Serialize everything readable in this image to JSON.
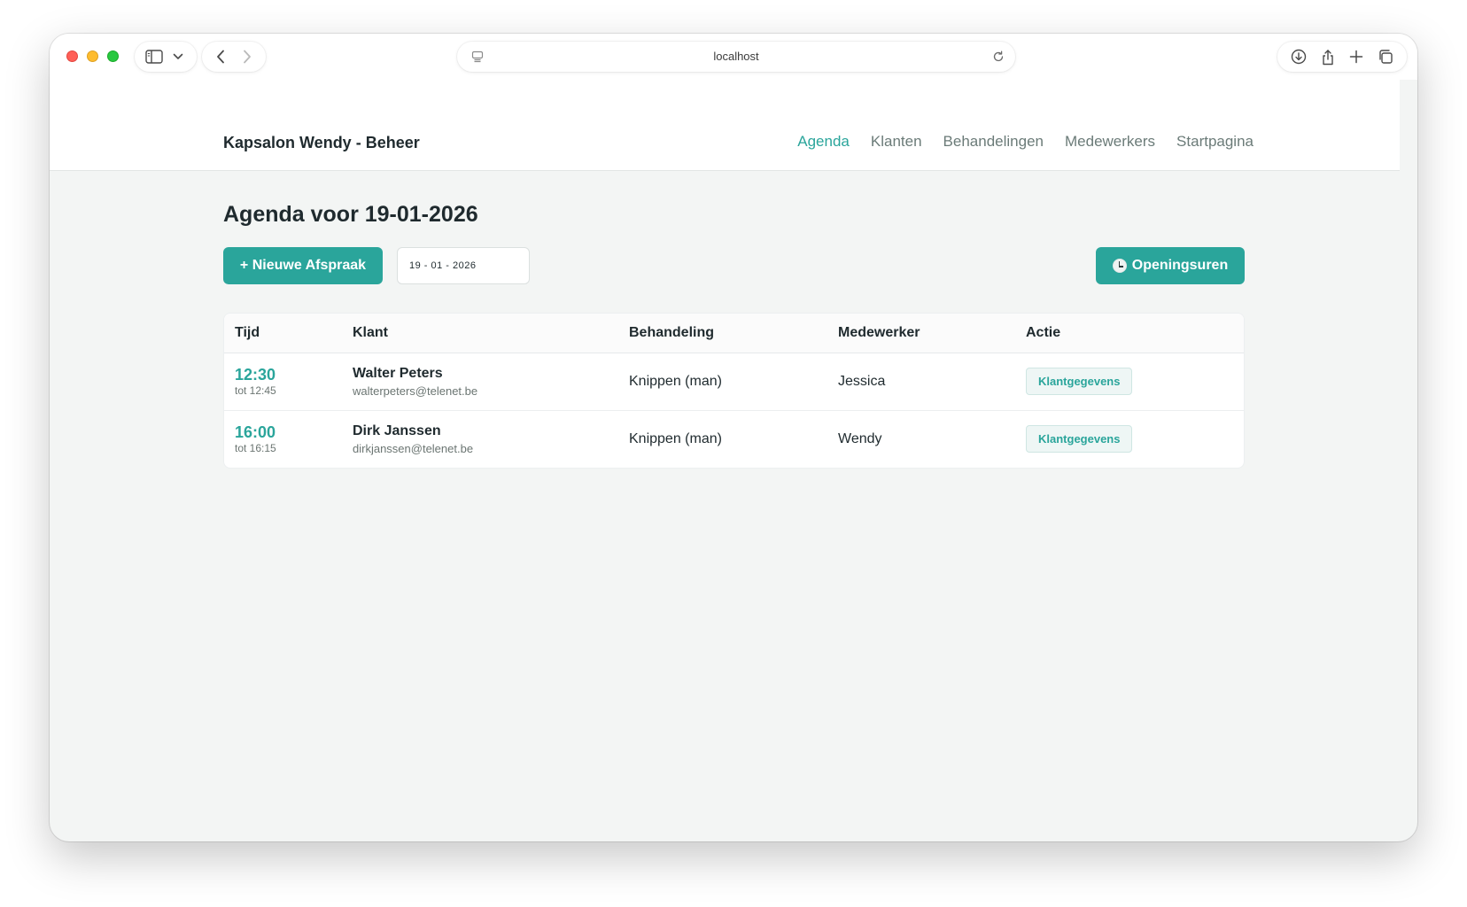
{
  "browser": {
    "url": "localhost"
  },
  "app": {
    "brand": "Kapsalon Wendy - Beheer",
    "nav": [
      {
        "label": "Agenda",
        "active": true
      },
      {
        "label": "Klanten",
        "active": false
      },
      {
        "label": "Behandelingen",
        "active": false
      },
      {
        "label": "Medewerkers",
        "active": false
      },
      {
        "label": "Startpagina",
        "active": false
      }
    ]
  },
  "page": {
    "title": "Agenda voor 19-01-2026",
    "new_button": "+ Nieuwe Afspraak",
    "date_value": "19 - 01 - 2026",
    "hours_button": "Openingsuren"
  },
  "table": {
    "headers": {
      "time": "Tijd",
      "client": "Klant",
      "treatment": "Behandeling",
      "staff": "Medewerker",
      "action": "Actie"
    },
    "rows": [
      {
        "time": "12:30",
        "until": "tot 12:45",
        "client_name": "Walter Peters",
        "client_email": "walterpeters@telenet.be",
        "treatment": "Knippen (man)",
        "staff": "Jessica",
        "action": "Klantgegevens"
      },
      {
        "time": "16:00",
        "until": "tot 16:15",
        "client_name": "Dirk Janssen",
        "client_email": "dirkjanssen@telenet.be",
        "treatment": "Knippen (man)",
        "staff": "Wendy",
        "action": "Klantgegevens"
      }
    ]
  },
  "colors": {
    "accent": "#2aa59b",
    "background": "#f3f5f4"
  }
}
